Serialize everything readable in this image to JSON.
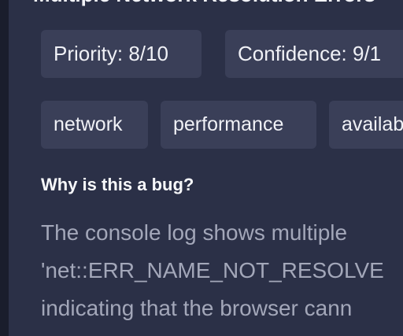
{
  "bug": {
    "title": "Multiple Network Resolution Errors",
    "priority_label": "Priority: 8/10",
    "confidence_label": "Confidence: 9/1",
    "tags": [
      "network",
      "performance",
      "availab"
    ],
    "section_heading": "Why is this a bug?",
    "description_lines": [
      "The console log shows multiple",
      "'net::ERR_NAME_NOT_RESOLVE",
      "indicating that the browser cann"
    ]
  }
}
